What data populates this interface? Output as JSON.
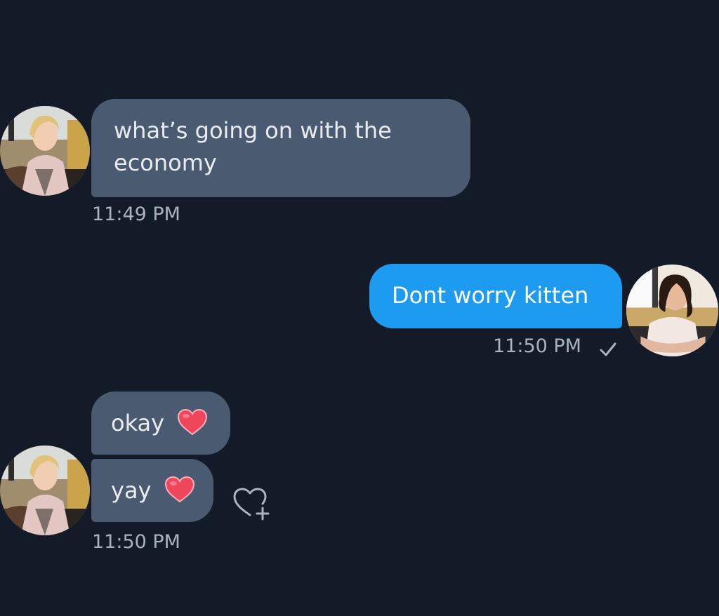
{
  "messages": [
    {
      "side": "incoming",
      "text": "what’s going on with the economy",
      "time": "11:49 PM"
    },
    {
      "side": "outgoing",
      "text": "Dont worry kitten",
      "time": "11:50 PM"
    },
    {
      "side": "incoming",
      "text": "okay",
      "emoji": "red-heart"
    },
    {
      "side": "incoming",
      "text": "yay",
      "emoji": "red-heart",
      "time": "11:50 PM"
    }
  ],
  "icons": {
    "read_receipt": "check-icon",
    "reaction": "heart-plus-icon",
    "emoji": "red-heart-icon"
  },
  "colors": {
    "background": "#141b28",
    "incoming_bubble": "#4a5a70",
    "outgoing_bubble": "#1d9bf0",
    "timestamp": "#aab3bf",
    "heart": "#f0465c"
  }
}
